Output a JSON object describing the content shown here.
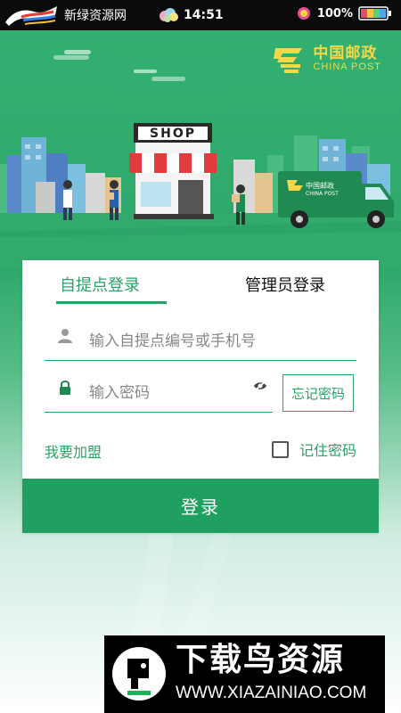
{
  "status_bar": {
    "site_name": "新绿资源网",
    "time": "14:51",
    "battery_percent": "100%",
    "icons": [
      "horse-logo-icon",
      "weather-icon",
      "sun-indicator-icon",
      "battery-icon"
    ]
  },
  "brand": {
    "name_cn": "中国邮政",
    "name_en": "CHINA POST",
    "color": "#f2d84a"
  },
  "hero": {
    "shop_sign": "SHOP",
    "truck_label": "中国邮政",
    "truck_label_en": "CHINA POST"
  },
  "login_card": {
    "tabs": [
      {
        "label": "自提点登录",
        "active": true
      },
      {
        "label": "管理员登录",
        "active": false
      }
    ],
    "account_input": {
      "placeholder": "输入自提点编号或手机号",
      "value": ""
    },
    "password_input": {
      "placeholder": "输入密码",
      "value": ""
    },
    "forgot_password": "忘记密码",
    "join_link": "我要加盟",
    "remember_password": {
      "label": "记住密码",
      "checked": false
    },
    "login_button": "登录"
  },
  "watermark": {
    "title": "下载鸟资源",
    "url": "WWW.XIAZAINIAO.COM"
  },
  "colors": {
    "accent": "#2aa266",
    "button": "#20a060",
    "hero_green": "#33b071"
  }
}
